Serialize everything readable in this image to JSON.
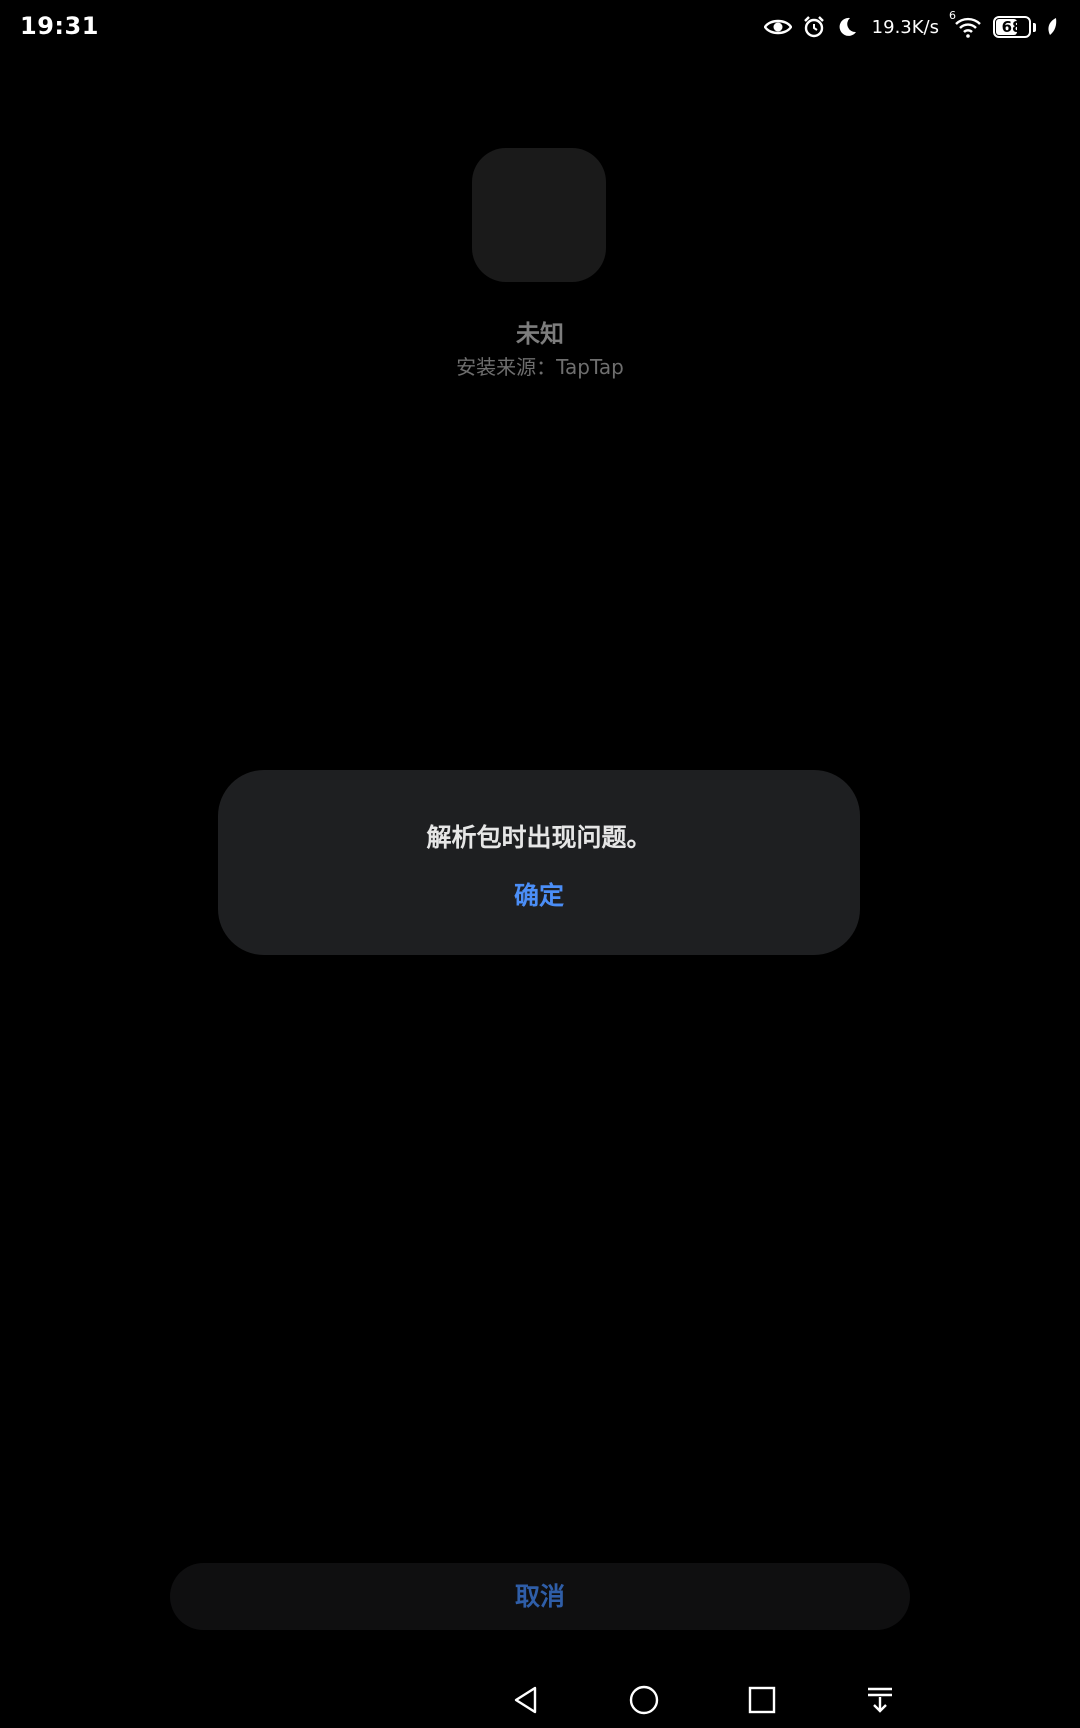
{
  "status_bar": {
    "time": "19:31",
    "network_speed": "19.3K/s",
    "signal_label": "6",
    "battery_level": "68",
    "battery_fraction": 0.68,
    "icons": [
      "eye-icon",
      "alarm-icon",
      "moon-icon",
      "wifi-icon",
      "battery-icon",
      "leaf-icon"
    ]
  },
  "app_info": {
    "name": "未知",
    "install_source": "安装来源：TapTap"
  },
  "dialog": {
    "message": "解析包时出现问题。",
    "confirm_label": "确定"
  },
  "cancel_label": "取消",
  "nav_bar": {
    "icons": [
      "back-icon",
      "home-icon",
      "recents-icon",
      "notification-pulldown-icon"
    ]
  },
  "colors": {
    "background": "#000000",
    "dialog_background": "#1e1f21",
    "accent": "#4b8ef7",
    "cancel_text": "#2f5ea8"
  }
}
